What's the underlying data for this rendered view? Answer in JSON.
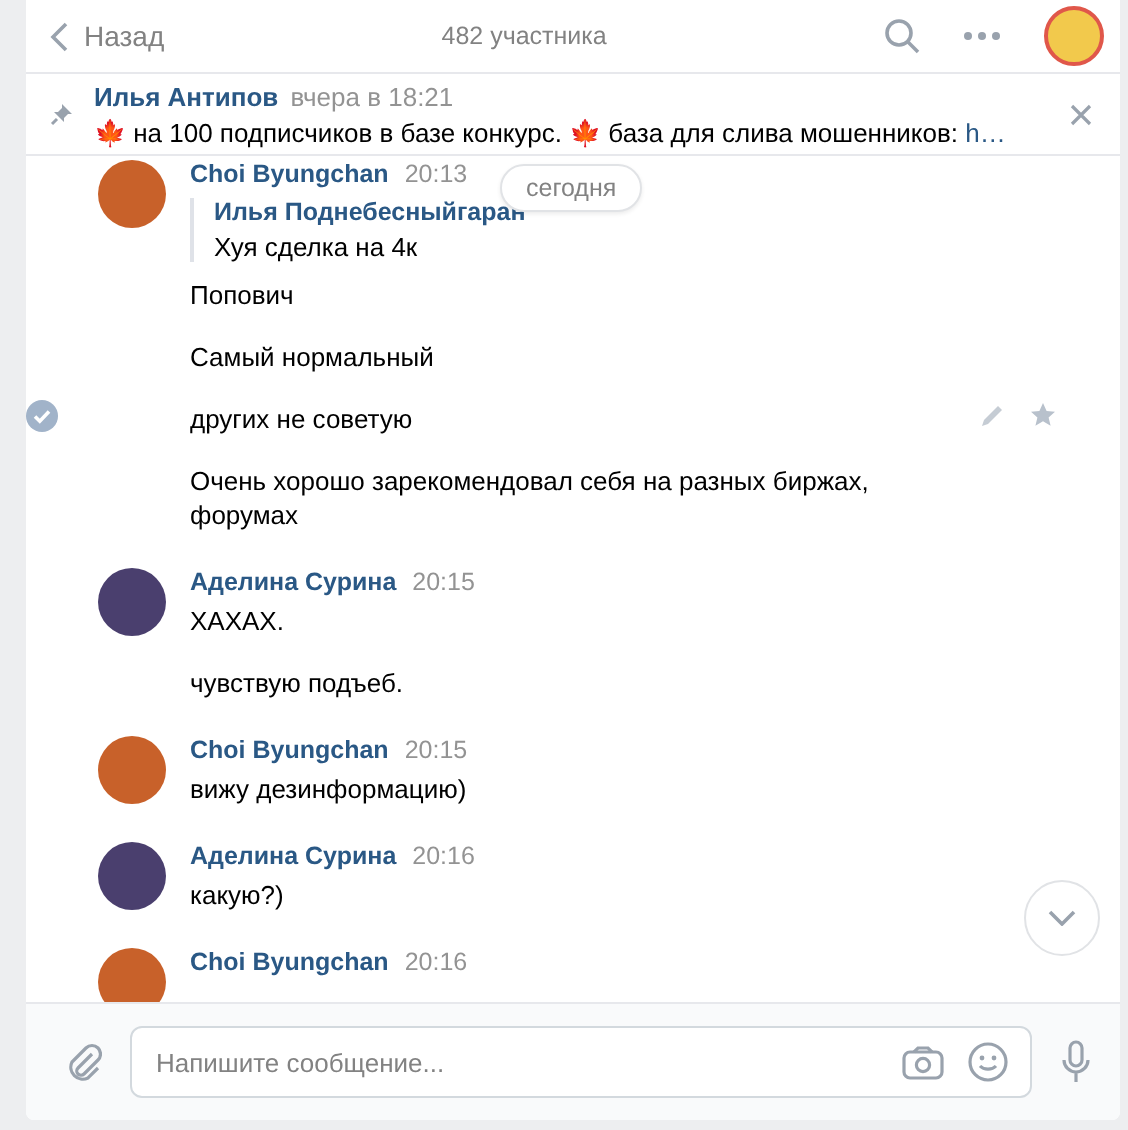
{
  "header": {
    "back": "Назад",
    "subtitle": "482 участника"
  },
  "pinned": {
    "author": "Илья Антипов",
    "time": "вчера в 18:21",
    "text": "🍁 на 100 подписчиков в базе конкурс. 🍁 база для слива мошенников: ",
    "link": "h…"
  },
  "date_badge": "сегодня",
  "groups": [
    {
      "author": "Choi Byungchan",
      "time": "20:13",
      "color": "#c8612a",
      "quote": {
        "author": "Илья Поднебесныйгаран",
        "text": "Хуя сделка на 4к"
      },
      "messages": [
        {
          "text": "Попович",
          "selected": false
        },
        {
          "text": "Самый нормальный",
          "selected": false
        },
        {
          "text": "других не советую",
          "selected": true
        },
        {
          "text": "Очень хорошо зарекомендовал себя на разных биржах, форумах",
          "selected": false
        }
      ]
    },
    {
      "author": "Аделина Сурина",
      "time": "20:15",
      "color": "#4a3f6e",
      "messages": [
        {
          "text": "ХАХАХ.",
          "selected": false
        },
        {
          "text": "чувствую подъеб.",
          "selected": false
        }
      ]
    },
    {
      "author": "Choi Byungchan",
      "time": "20:15",
      "color": "#c8612a",
      "messages": [
        {
          "text": "вижу дезинформацию)",
          "selected": false
        }
      ]
    },
    {
      "author": "Аделина Сурина",
      "time": "20:16",
      "color": "#4a3f6e",
      "messages": [
        {
          "text": "какую?)",
          "selected": false
        }
      ]
    },
    {
      "author": "Choi Byungchan",
      "time": "20:16",
      "color": "#c8612a"
    }
  ],
  "composer": {
    "placeholder": "Напишите сообщение..."
  }
}
